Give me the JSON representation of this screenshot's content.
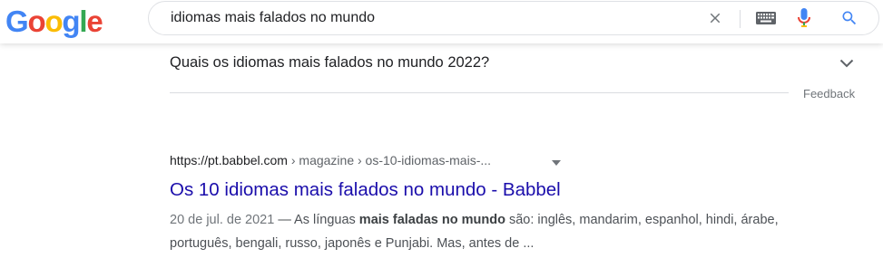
{
  "logo": {
    "letters": [
      "G",
      "o",
      "o",
      "g",
      "l",
      "e"
    ]
  },
  "search": {
    "query": "idiomas mais falados no mundo"
  },
  "icons": {
    "clear": "close-icon",
    "keyboard": "keyboard-icon",
    "mic": "mic-icon",
    "search": "search-icon",
    "expand": "chevron-down-icon",
    "cite_menu": "caret-down-icon"
  },
  "related": {
    "question": "Quais os idiomas mais falados no mundo 2022?",
    "feedback_label": "Feedback"
  },
  "result": {
    "cite_domain": "https://pt.babbel.com",
    "cite_path": " › magazine › os-10-idiomas-mais-...",
    "title": "Os 10 idiomas mais falados no mundo - Babbel",
    "date": "20 de jul. de 2021",
    "snippet_prefix": " — As línguas ",
    "snippet_bold": "mais faladas no mundo",
    "snippet_suffix": " são: inglês, mandarim, espanhol, hindi, árabe, português, bengali, russo, japonês e Punjabi. Mas, antes de ..."
  },
  "colors": {
    "link": "#1a0dab",
    "blue": "#4285F4",
    "red": "#EA4335",
    "yellow": "#FBBC05",
    "green": "#34A853",
    "muted": "#70757a"
  }
}
